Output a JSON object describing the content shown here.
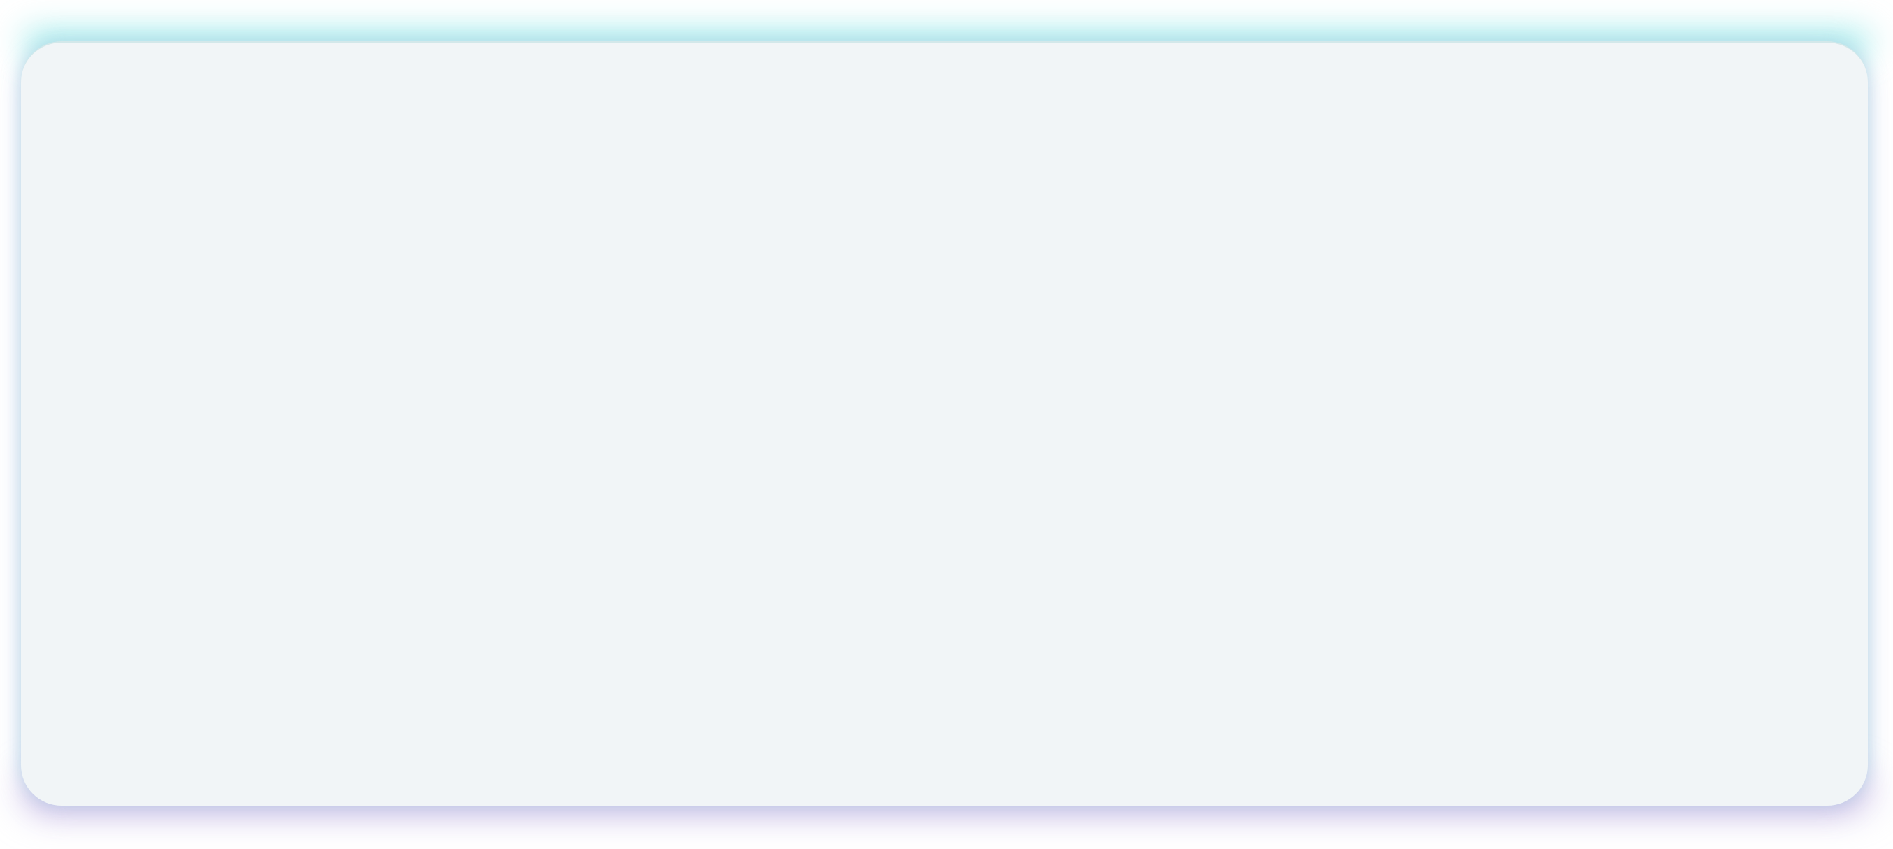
{
  "colors": {
    "page_background": "#ffffff",
    "card_background": "#f1f5f7",
    "top_glow": "#78e1e1",
    "bottom_glow": "#beafe1"
  }
}
